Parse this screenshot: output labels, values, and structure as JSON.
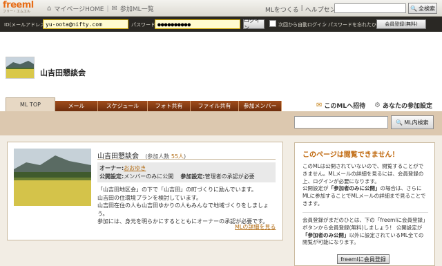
{
  "header": {
    "logo": "freeml",
    "logo_tagline": "フリー・エムエル",
    "mypage": "マイページHOME",
    "joined_list": "参加ML一覧",
    "create_ml": "MLをつくる",
    "help": "ヘルプセンター",
    "search_button": "全検索"
  },
  "login": {
    "email_label": "ID(メールアドレス)",
    "email_value": "yu-oota@nifty.com",
    "password_label": "パスワード",
    "password_value": "●●●●●●●●●●",
    "login_button": "ログイン",
    "auto_login": "次回から自動ログイン",
    "forgot": "パスワードを忘れたひと",
    "register_button": "会員登録(無料)"
  },
  "ml": {
    "title": "山吉田懇談会",
    "member_label": "(参加人数",
    "member_count": "55人",
    "member_close": ")",
    "owner_label": "オーナー:",
    "owner_name": "おおゆき",
    "public_label": "公開設定:",
    "public_value": "メンバーのみに公開",
    "join_label": "参加設定:",
    "join_value": "管理者の承認が必要",
    "desc1": "「山吉田地区会」の下で「山吉田」の町づくりに励んでいます。",
    "desc2": "山吉田の住環境プランを検討しています。",
    "desc3": "山吉田在住の人も山吉田ゆかりの人もみんなで地域づくりをしましょう。",
    "desc4": "参加には、身元を明らかにするとともにオーナーの承認が必要です。",
    "detail_link": "MLの詳細を見る"
  },
  "tabs": [
    "ML TOP",
    "メール",
    "スケジュール",
    "フォト共有",
    "ファイル共有",
    "参加メンバー"
  ],
  "tab_actions": {
    "invite": "このMLへ招待",
    "settings": "あなたの参加設定"
  },
  "ml_search_button": "ML内検索",
  "side": {
    "heading": "このページは閲覧できません！",
    "p1": "このMLは公開されていないので、閲覧することができません。MLメールの詳細を見るには、会員登録の上、ログインが必要になります。",
    "p2a": "公開設定が",
    "p2b": "「参加者のみに公開」",
    "p2c": "の場合は、さらにMLに参加することでMLメールの詳細まで見ることできます。",
    "p3a": "会員登録がまだのひとは、下の「freemlに会員登録」ボタンから会員登録(無料)しましょう！ 公開設定が",
    "p3b": "「参加者のみ公開」",
    "p3c": "以外に設定されているML全ての閲覧が可能になります。",
    "button": "freemlに会員登録"
  },
  "colors": {
    "accent": "#e76c16",
    "tab": "#8a3b12",
    "band": "#dcc8af"
  }
}
